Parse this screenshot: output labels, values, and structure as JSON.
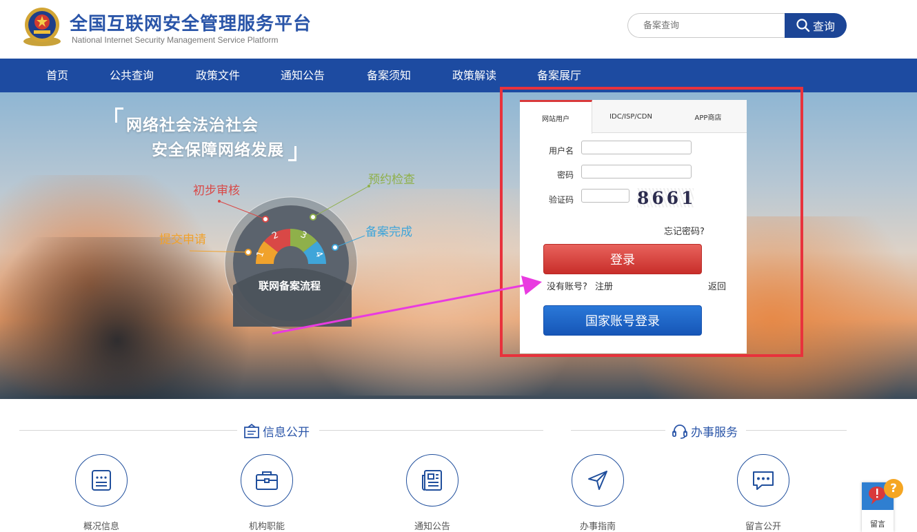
{
  "header": {
    "title": "全国互联网安全管理服务平台",
    "subtitle": "National Internet Security Management Service Platform",
    "search_placeholder": "备案查询",
    "search_button": "查询"
  },
  "nav": {
    "items": [
      "首页",
      "公共查询",
      "政策文件",
      "通知公告",
      "备案须知",
      "政策解读",
      "备案展厅"
    ]
  },
  "hero": {
    "slogan_line1": "网络社会法治社会",
    "slogan_line2": "安全保障网络发展",
    "flow": {
      "center_label": "联网备案流程",
      "steps": [
        {
          "num": "1",
          "label": "提交申请",
          "color": "#f0a22c"
        },
        {
          "num": "2",
          "label": "初步审核",
          "color": "#d94846"
        },
        {
          "num": "3",
          "label": "预约检查",
          "color": "#8fb04a"
        },
        {
          "num": "4",
          "label": "备案完成",
          "color": "#3fa5d9"
        }
      ]
    }
  },
  "login": {
    "tabs": [
      "网站用户",
      "IDC/ISP/CDN",
      "APP商店"
    ],
    "active_tab": "网站用户",
    "username_label": "用户名",
    "password_label": "密码",
    "captcha_label": "验证码",
    "captcha_text": "8661",
    "forgot": "忘记密码?",
    "login_button": "登录",
    "no_account": "没有账号?",
    "register": "注册",
    "back": "返回",
    "national_login": "国家账号登录",
    "username_value": "",
    "password_value": "",
    "captcha_value": ""
  },
  "sections": {
    "info_title": "信息公开",
    "service_title": "办事服务",
    "items": [
      {
        "label": "概况信息",
        "icon": "document-list-icon"
      },
      {
        "label": "机构职能",
        "icon": "briefcase-icon"
      },
      {
        "label": "通知公告",
        "icon": "newspaper-icon"
      },
      {
        "label": "办事指南",
        "icon": "navigation-arrow-icon"
      },
      {
        "label": "留言公开",
        "icon": "chat-bubble-icon"
      }
    ]
  },
  "widget": {
    "label": "留言",
    "badge": "?"
  },
  "colors": {
    "brand_blue": "#1d4ba1",
    "title_blue": "#2a55a8",
    "login_red": "#d9393b",
    "national_blue": "#1656b7",
    "highlight_frame": "#e8323c",
    "arrow_magenta": "#e93be0"
  }
}
